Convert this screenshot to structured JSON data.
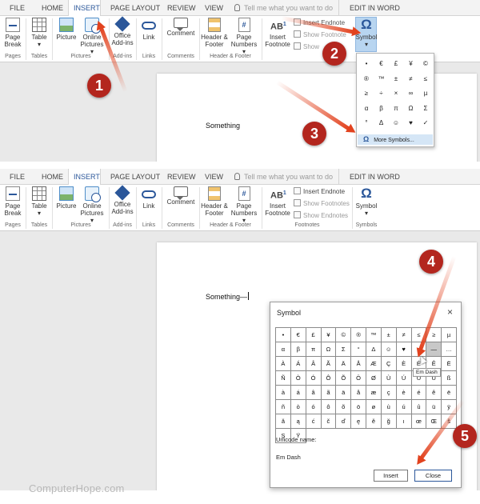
{
  "tabs": [
    "FILE",
    "HOME",
    "INSERT",
    "PAGE LAYOUT",
    "REVIEW",
    "VIEW"
  ],
  "active_tab": "INSERT",
  "tell_me_placeholder": "Tell me what you want to do",
  "edit_in_word": "EDIT IN WORD",
  "ribbon": {
    "page_break": "Page Break",
    "table": "Table",
    "picture": "Picture",
    "online_pictures": "Online Pictures",
    "office_addins": "Office Add-ins",
    "link": "Link",
    "comment": "Comment",
    "header_footer": "Header & Footer",
    "page_numbers": "Page Numbers",
    "insert_footnote": "Insert Footnote",
    "insert_endnote": "Insert Endnote",
    "show_footnotes": "Show Footnotes",
    "show_endnotes": "Show Endnotes",
    "symbol": "Symbol",
    "footnote_glyph": "AB",
    "footnote_sup": "1",
    "omega": "Ω"
  },
  "groups": {
    "pages": "Pages",
    "tables": "Tables",
    "pictures": "Pictures",
    "addins": "Add-ins",
    "links": "Links",
    "comments": "Comments",
    "header_footer": "Header & Footer",
    "footnotes": "Footnotes",
    "symbols": "Symbols"
  },
  "top_panel": {
    "doc_text": "Something",
    "ribbon_endnote": "Insert Endnote",
    "ribbon_showfoot": "Show Footnote",
    "ribbon_showend": "Show"
  },
  "dropdown_symbols": [
    "•",
    "€",
    "£",
    "¥",
    "©",
    "®",
    "™",
    "±",
    "≠",
    "≤",
    "≥",
    "÷",
    "×",
    "∞",
    "µ",
    "α",
    "β",
    "π",
    "Ω",
    "Σ",
    "°",
    "Δ",
    "☺",
    "♥",
    "✓"
  ],
  "more_symbols": "More Symbols...",
  "bottom_panel": {
    "doc_text": "Something—"
  },
  "dialog": {
    "title": "Symbol",
    "close_glyph": "×",
    "chars": [
      "•",
      "€",
      "£",
      "¥",
      "©",
      "®",
      "™",
      "±",
      "≠",
      "≤",
      "≥",
      "µ",
      "α",
      "β",
      "π",
      "Ω",
      "Σ",
      "°",
      "Δ",
      "☺",
      "♥",
      "¿",
      "—",
      "…",
      "À",
      "Á",
      "Â",
      "Ã",
      "Ä",
      "Å",
      "Æ",
      "Ç",
      "È",
      "É",
      "Ê",
      "Ë",
      "Ñ",
      "Ò",
      "Ó",
      "Ô",
      "Õ",
      "Ö",
      "Ø",
      "Ù",
      "Ú",
      "Û",
      "Ü",
      "ß",
      "à",
      "á",
      "â",
      "ã",
      "ä",
      "å",
      "æ",
      "ç",
      "è",
      "é",
      "ê",
      "ë",
      "ñ",
      "ò",
      "ó",
      "ô",
      "õ",
      "ö",
      "ø",
      "ù",
      "ú",
      "û",
      "ü",
      "ÿ",
      "ă",
      "ą",
      "ć",
      "č",
      "ď",
      "ę",
      "ě",
      "ğ",
      "ı",
      "œ",
      "Œ",
      "š",
      "Ş",
      "Ÿ"
    ],
    "selected_index": 22,
    "tooltip": "Em Dash",
    "unicode_label": "Unicode name:",
    "unicode_value": "Em Dash",
    "insert_button": "Insert",
    "close_button": "Close"
  },
  "steps": [
    "1",
    "2",
    "3",
    "4",
    "5"
  ],
  "footer_brand": "ComputerHope.com",
  "colors": {
    "accent": "#2b579a",
    "arrow": "#e2421e",
    "badge": "#b3261e"
  }
}
